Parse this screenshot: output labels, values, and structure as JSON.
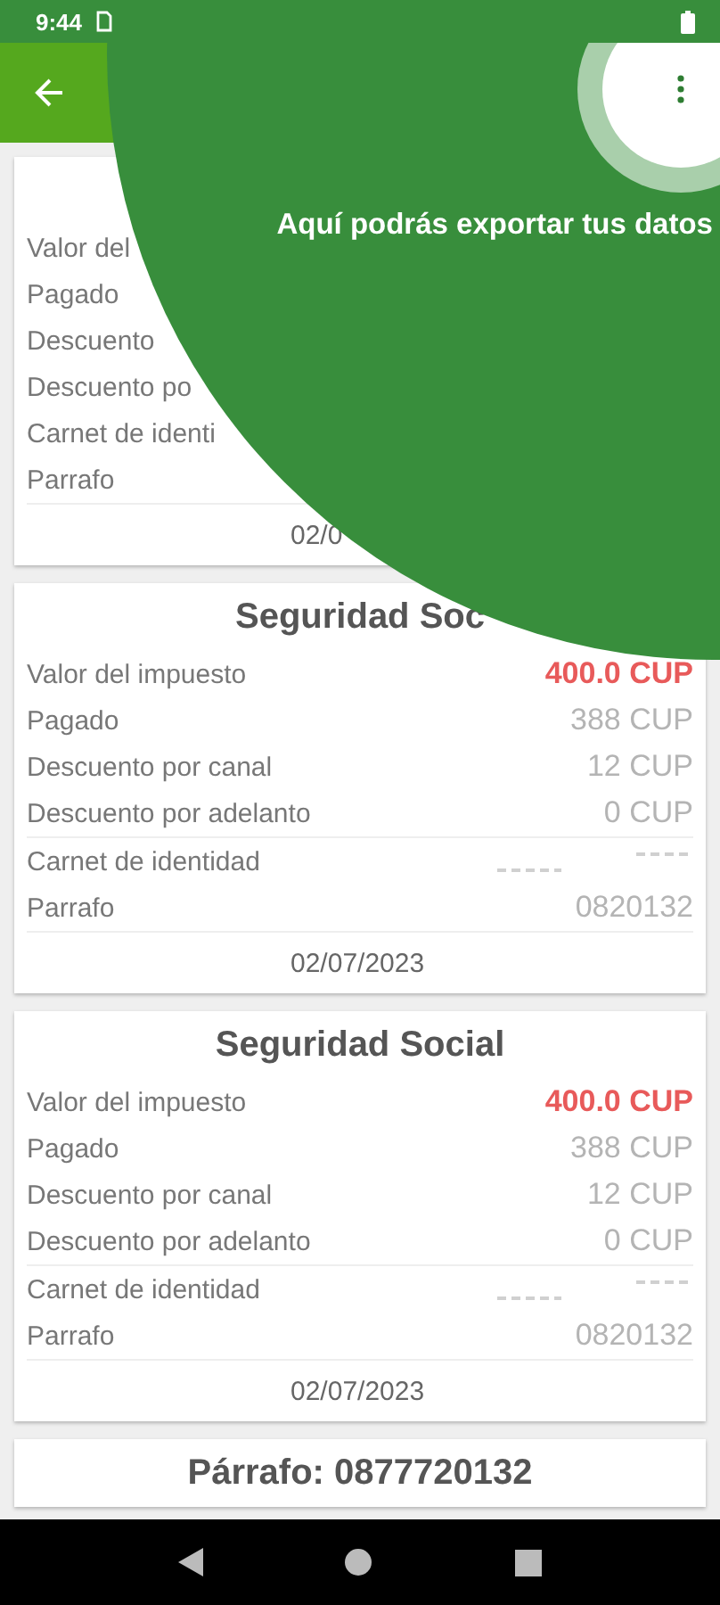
{
  "status_bar": {
    "time": "9:44"
  },
  "tooltip": {
    "text": "Aquí podrás exportar tus datos"
  },
  "cards": [
    {
      "rows": [
        {
          "label": "Valor del",
          "kind": "plain"
        },
        {
          "label": "Pagado",
          "kind": "plain"
        },
        {
          "label": "Descuento",
          "kind": "plain"
        },
        {
          "label": "Descuento po",
          "kind": "plain"
        },
        {
          "label": "Carnet de identi",
          "kind": "plain"
        },
        {
          "label": "Parrafo",
          "kind": "plain"
        }
      ],
      "date": "02/0"
    },
    {
      "title": "Seguridad Soc",
      "rows": [
        {
          "label": "Valor del impuesto",
          "value": "400.0 CUP",
          "kind": "tax"
        },
        {
          "label": "Pagado",
          "value": "388 CUP",
          "kind": "amount"
        },
        {
          "label": "Descuento por canal",
          "value": "12 CUP",
          "kind": "amount"
        },
        {
          "label": "Descuento por adelanto",
          "value": "0 CUP",
          "kind": "amount"
        },
        {
          "label": "Carnet de identidad",
          "kind": "redacted"
        },
        {
          "label": "Parrafo",
          "value": "0820132",
          "kind": "amount"
        }
      ],
      "date": "02/07/2023"
    },
    {
      "title": "Seguridad Social",
      "rows": [
        {
          "label": "Valor del impuesto",
          "value": "400.0 CUP",
          "kind": "tax"
        },
        {
          "label": "Pagado",
          "value": "388 CUP",
          "kind": "amount"
        },
        {
          "label": "Descuento por canal",
          "value": "12 CUP",
          "kind": "amount"
        },
        {
          "label": "Descuento por adelanto",
          "value": "0 CUP",
          "kind": "amount"
        },
        {
          "label": "Carnet de identidad",
          "kind": "redacted"
        },
        {
          "label": "Parrafo",
          "value": "0820132",
          "kind": "amount"
        }
      ],
      "date": "02/07/2023"
    },
    {
      "title": "Párrafo: 0877720132"
    }
  ]
}
